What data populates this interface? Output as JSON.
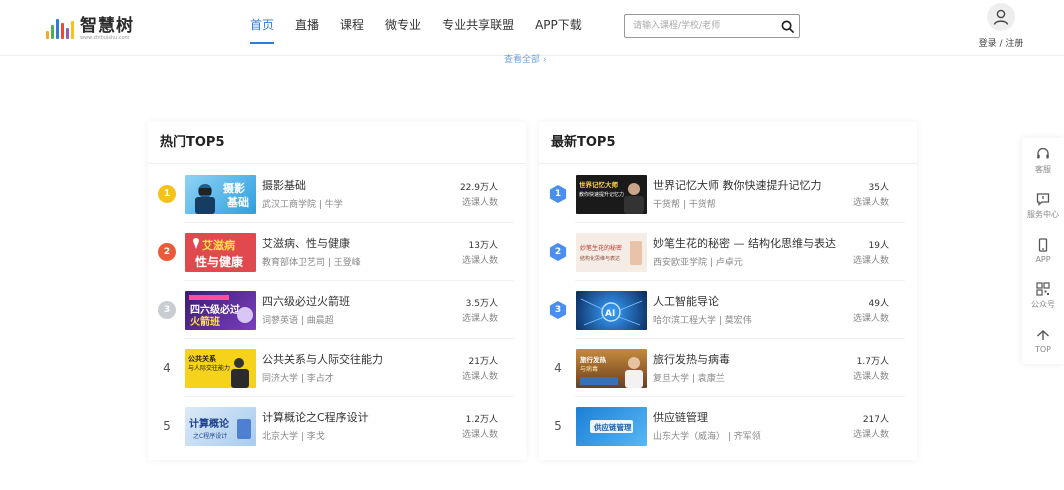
{
  "header": {
    "logo_text": "智慧树",
    "logo_sub": "www.zhihuishu.com",
    "nav": [
      {
        "label": "首页",
        "active": true
      },
      {
        "label": "直播",
        "active": false
      },
      {
        "label": "课程",
        "active": false
      },
      {
        "label": "微专业",
        "active": false
      },
      {
        "label": "专业共享联盟",
        "active": false
      },
      {
        "label": "APP下载",
        "active": false
      }
    ],
    "search_placeholder": "请输入课程/学校/老师",
    "login_label": "登录 / 注册"
  },
  "view_all": "查看全部 ›",
  "hot": {
    "title": "热门TOP5",
    "items": [
      {
        "rank": "1",
        "title": "摄影基础",
        "meta": "武汉工商学院 | 牛学",
        "count": "22.9万人",
        "count_label": "选课人数",
        "thumb_text": "摄影\n基础"
      },
      {
        "rank": "2",
        "title": "艾滋病、性与健康",
        "meta": "教育部体卫艺司 | 王登峰",
        "count": "13万人",
        "count_label": "选课人数",
        "thumb_text": "艾滋病\n性与健康"
      },
      {
        "rank": "3",
        "title": "四六级必过火箭班",
        "meta": "词蓼英语 | 曲晨超",
        "count": "3.5万人",
        "count_label": "选课人数",
        "thumb_text": "四六级必过\n火箭班"
      },
      {
        "rank": "4",
        "title": "公共关系与人际交往能力",
        "meta": "同济大学 | 李占才",
        "count": "21万人",
        "count_label": "选课人数",
        "thumb_text": "公共关系\n与人际交往能力"
      },
      {
        "rank": "5",
        "title": "计算概论之C程序设计",
        "meta": "北京大学 | 李戈",
        "count": "1.2万人",
        "count_label": "选课人数",
        "thumb_text": "计算概论\n之C程序设计"
      }
    ]
  },
  "latest": {
    "title": "最新TOP5",
    "items": [
      {
        "rank": "1",
        "title": "世界记忆大师 教你快速提升记忆力",
        "meta": "干货帮 | 干货帮",
        "count": "35人",
        "count_label": "选课人数",
        "thumb_text": "世界记忆大师\n教你快速提升记忆力"
      },
      {
        "rank": "2",
        "title": "妙笔生花的秘密 — 结构化思维与表达",
        "meta": "西安欧亚学院 | 卢卓元",
        "count": "19人",
        "count_label": "选课人数",
        "thumb_text": "妙笔生花的秘密\n结构化思维与表达"
      },
      {
        "rank": "3",
        "title": "人工智能导论",
        "meta": "哈尔滨工程大学 | 莫宏伟",
        "count": "49人",
        "count_label": "选课人数",
        "thumb_text": "AI"
      },
      {
        "rank": "4",
        "title": "旅行发热与病毒",
        "meta": "复旦大学 | 袁康兰",
        "count": "1.7万人",
        "count_label": "选课人数",
        "thumb_text": "旅行发热\n与病毒"
      },
      {
        "rank": "5",
        "title": "供应链管理",
        "meta": "山东大学（威海） | 齐军领",
        "count": "217人",
        "count_label": "选课人数",
        "thumb_text": "供应链管理"
      }
    ]
  },
  "sidebar": [
    {
      "label": "客服",
      "icon": "headset-icon"
    },
    {
      "label": "服务中心",
      "icon": "message-icon"
    },
    {
      "label": "APP",
      "icon": "phone-icon"
    },
    {
      "label": "公众号",
      "icon": "qrcode-icon"
    },
    {
      "label": "TOP",
      "icon": "arrow-up-icon"
    }
  ],
  "colors": {
    "accent": "#2f7bd9",
    "gold": "#f5c21b",
    "red": "#ea5b3a",
    "silver": "#c9ccd2",
    "hex_blue": "#4a8ef0"
  }
}
